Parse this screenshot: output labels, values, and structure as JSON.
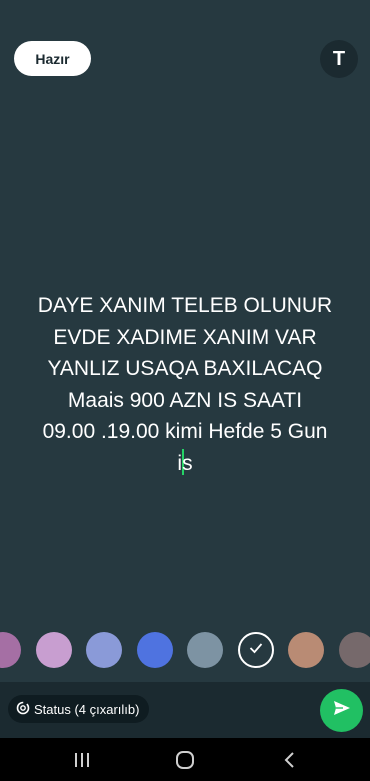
{
  "header": {
    "done_label": "Hazır",
    "text_tool_label": "T"
  },
  "status_text": {
    "lines": [
      "DAYE XANIM TELEB OLUNUR",
      "EVDE XADIME XANIM VAR",
      "YANLIZ USAQA BAXILACAQ",
      "Maais 900 AZN IS SAATI",
      "09.00 .19.00 kimi Hefde 5 Gun"
    ],
    "last_line_before_caret": "i",
    "last_line_after_caret": "s"
  },
  "palette": {
    "colors": [
      "#a56fa4",
      "#c89ed0",
      "#8a9ad8",
      "#4f73e0",
      "#7d93a3",
      "#263940",
      "#b98b74",
      "#76696b"
    ],
    "selected_index": 5,
    "icon": "check-icon"
  },
  "footer": {
    "status_label": "Status (4 çıxarılıb)",
    "status_icon": "privacy-icon",
    "send_icon": "send-icon"
  },
  "nav": {
    "icons": [
      "recent-apps-icon",
      "home-icon",
      "back-icon"
    ]
  },
  "colors": {
    "background": "#263940",
    "accent": "#21c063",
    "caret": "#25d366"
  }
}
